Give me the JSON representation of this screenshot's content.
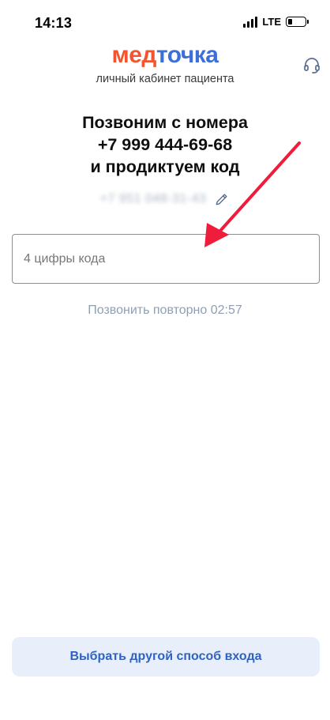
{
  "status_bar": {
    "time": "14:13",
    "network": "LTE",
    "battery_level": 0.2
  },
  "brand": {
    "logo_part1": "мед",
    "logo_part2": "точка",
    "subtitle": "личный кабинет пациента",
    "colors": {
      "logo_orange": "#f4532f",
      "logo_blue": "#3d6fd8"
    }
  },
  "header": {
    "support_icon": "headset-icon"
  },
  "verification": {
    "line1": "Позвоним с номера",
    "line2": "+7 999 444-69-68",
    "line3": "и продиктуем код",
    "user_phone": "+7 951 048-31-43",
    "edit_icon": "pencil-icon"
  },
  "code_input": {
    "placeholder": "4 цифры кода",
    "value": ""
  },
  "resend": {
    "label": "Позвонить повторно 02:57"
  },
  "footer": {
    "alt_login_label": "Выбрать другой способ входа",
    "colors": {
      "button_bg": "#e9effa",
      "button_text": "#2e63c4"
    }
  },
  "annotation": {
    "arrow_color": "#ef1d3b"
  }
}
